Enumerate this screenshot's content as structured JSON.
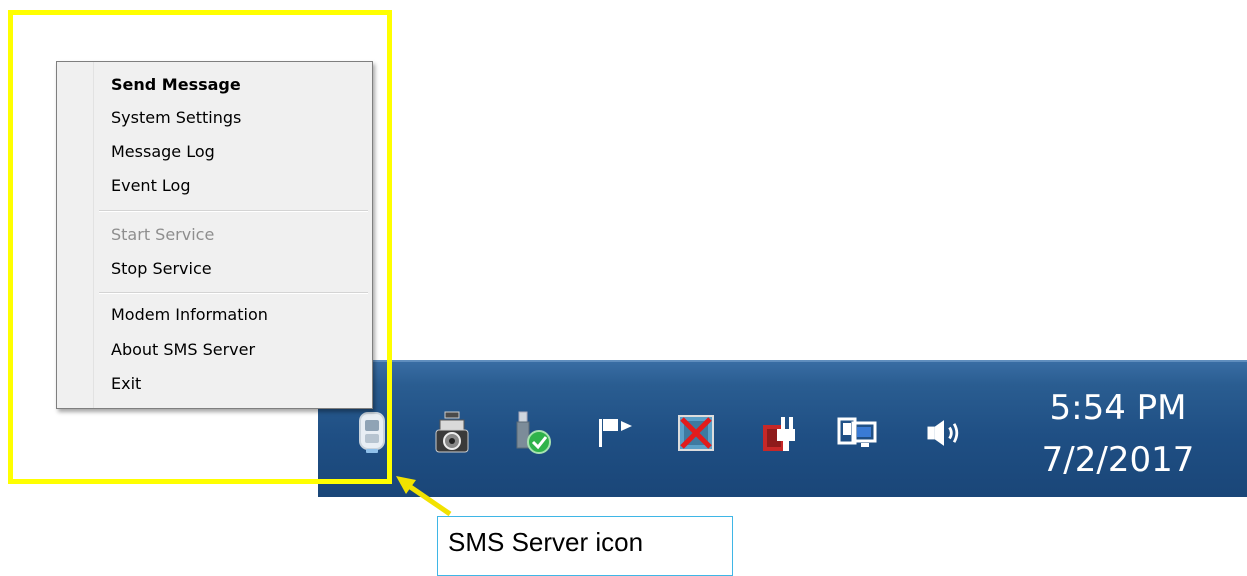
{
  "context_menu": {
    "items": [
      {
        "label": "Send Message",
        "bold": true,
        "enabled": true
      },
      {
        "label": "System Settings",
        "enabled": true
      },
      {
        "label": "Message Log",
        "enabled": true
      },
      {
        "label": "Event Log",
        "enabled": true
      },
      {
        "label": "Start Service",
        "enabled": false
      },
      {
        "label": "Stop Service",
        "enabled": true
      },
      {
        "label": "Modem Information",
        "enabled": true
      },
      {
        "label": "About SMS Server",
        "enabled": true
      },
      {
        "label": "Exit",
        "enabled": true
      }
    ]
  },
  "taskbar": {
    "tray_icons": [
      "sms-server-icon",
      "camera-icon",
      "usb-shield-icon",
      "flag-icon",
      "display-x-icon",
      "power-plug-icon",
      "network-icon",
      "volume-icon"
    ],
    "clock_time": "5:54 PM",
    "clock_date": "7/2/2017"
  },
  "annotation": {
    "callout_text": "SMS Server icon",
    "highlight_color": "#ffff00",
    "callout_border_color": "#3fb6e6"
  }
}
